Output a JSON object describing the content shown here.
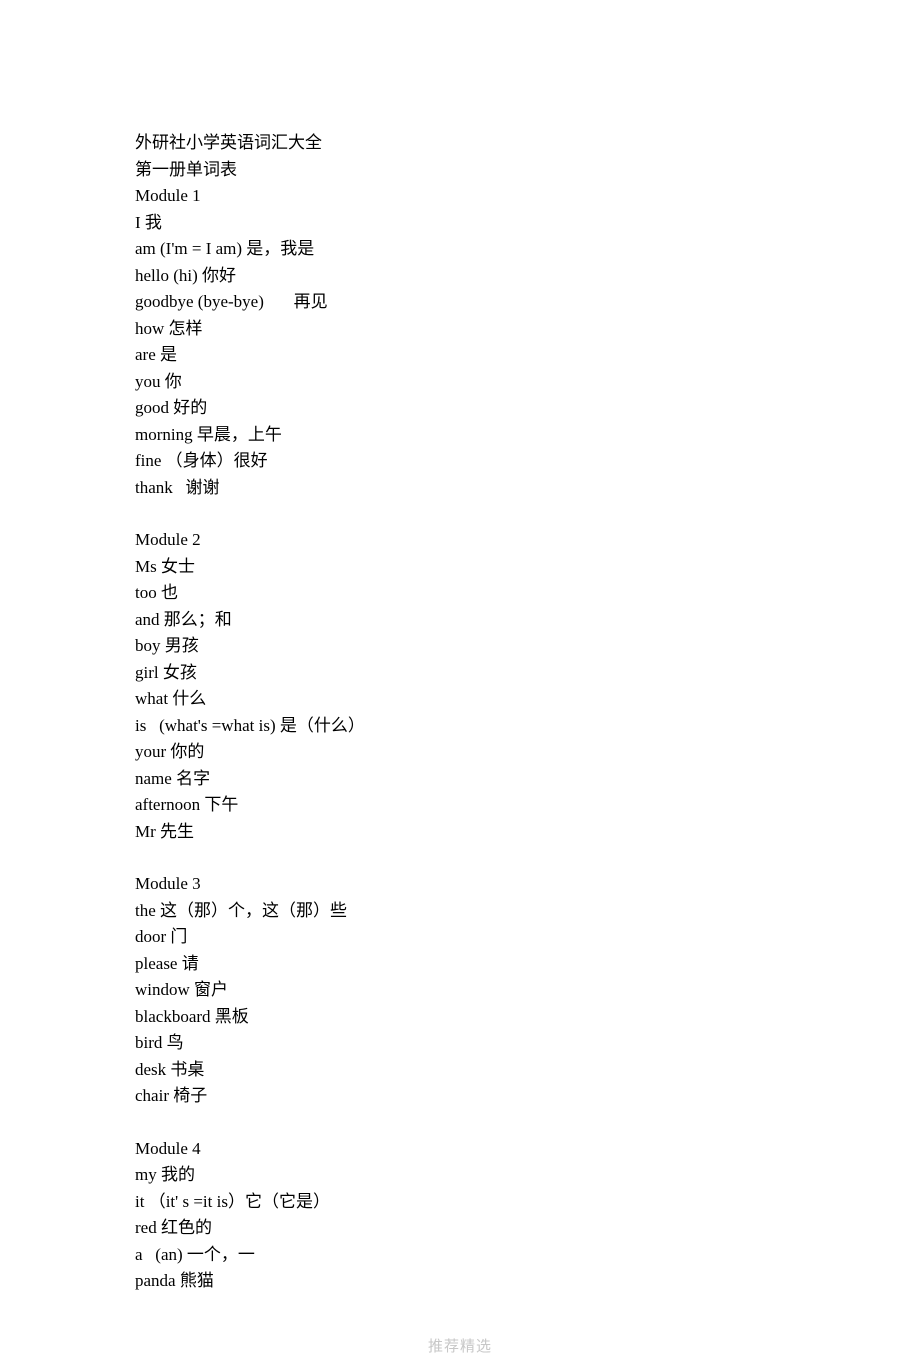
{
  "title": "外研社小学英语词汇大全",
  "subtitle": "第一册单词表",
  "footer": "推荐精选",
  "modules": [
    {
      "header": "Module 1",
      "entries": [
        "I 我",
        "am (I'm = I am) 是，我是",
        "hello (hi) 你好",
        "goodbye (bye-bye)       再见",
        "how 怎样",
        "are 是",
        "you 你",
        "good 好的",
        "morning 早晨，上午",
        "fine （身体）很好",
        "thank   谢谢"
      ]
    },
    {
      "header": "Module 2",
      "entries": [
        "Ms 女士",
        "too 也",
        "and 那么；和",
        "boy 男孩",
        "girl 女孩",
        "what 什么",
        "is   (what's =what is) 是（什么）",
        "your 你的",
        "name 名字",
        "afternoon 下午",
        "Mr 先生"
      ]
    },
    {
      "header": "Module 3",
      "entries": [
        "the 这（那）个，这（那）些",
        "door 门",
        "please 请",
        "window 窗户",
        "blackboard 黑板",
        "bird 鸟",
        "desk 书桌",
        "chair 椅子"
      ]
    },
    {
      "header": "Module 4",
      "entries": [
        "my 我的",
        "it （it' s =it is）它（它是）",
        "red 红色的",
        "a   (an) 一个，一",
        "panda 熊猫"
      ]
    }
  ]
}
